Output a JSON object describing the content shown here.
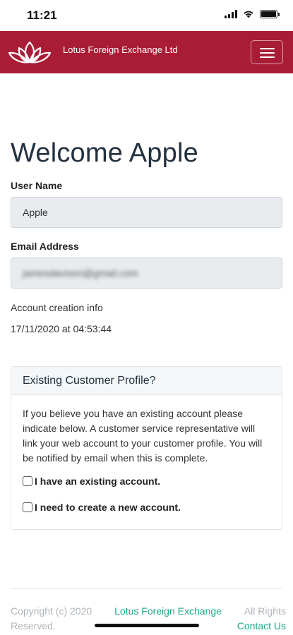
{
  "status_bar": {
    "time": "11:21"
  },
  "navbar": {
    "brand_name": "Lotus Foreign Exchange Ltd",
    "accent_color": "#a81d35",
    "menu_icon": "hamburger-icon"
  },
  "main": {
    "title": "Welcome Apple",
    "username": {
      "label": "User Name",
      "value": "Apple"
    },
    "email": {
      "label": "Email Address",
      "value": "jamesdavison@gmail.com"
    },
    "account_info": {
      "label": "Account creation info",
      "value": "17/11/2020 at 04:53:44"
    }
  },
  "profile_card": {
    "header": "Existing Customer Profile?",
    "body": "If you believe you have an existing account please indicate below. A customer service representative will link your web account to your customer profile. You will be notified by email when this is complete.",
    "options": [
      {
        "label": "I have an existing account.",
        "checked": false
      },
      {
        "label": "I need to create a new account.",
        "checked": false
      }
    ]
  },
  "footer": {
    "copyright": "Copyright (c) 2020",
    "company_link": "Lotus Foreign Exchange",
    "all_rights": "All Rights",
    "reserved": "Reserved.",
    "contact_link": "Contact Us",
    "link_color": "#1ca98a"
  }
}
